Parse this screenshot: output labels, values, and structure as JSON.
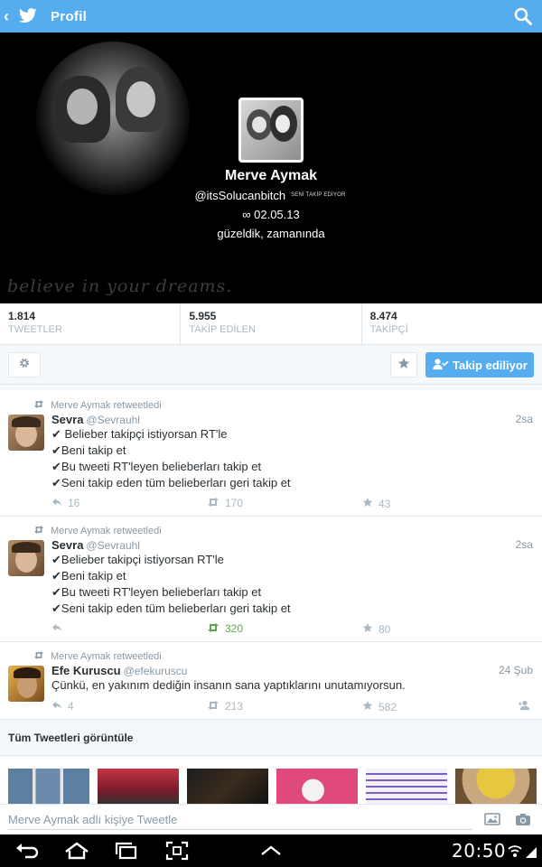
{
  "actionbar": {
    "back_icon": "back-chevron-icon",
    "logo_icon": "twitter-bird-icon",
    "title": "Profil",
    "search_icon": "search-icon"
  },
  "profile": {
    "name": "Merve Aymak",
    "handle": "@itsSolucanbitch",
    "follows_you": "SENİ TAKİP EDİYOR",
    "bio_line1": "∞ 02.05.13",
    "bio_line2": "güzeldik, zamanında",
    "header_watermark": "believe in your dreams."
  },
  "stats": [
    {
      "value": "1.814",
      "label": "TWEETLER"
    },
    {
      "value": "5.955",
      "label": "TAKİP EDİLEN"
    },
    {
      "value": "8.474",
      "label": "TAKİPÇİ"
    }
  ],
  "buttons": {
    "following": "Takip ediliyor"
  },
  "tweets": [
    {
      "retweeted_by": "Merve Aymak retweetledi",
      "name": "Sevra",
      "handle": "@Sevrauhl",
      "time": "2sa",
      "lines": [
        "✔ Belieber takipçi istiyorsan RT'le",
        "✔Beni takip et",
        "✔Bu tweeti RT'leyen belieberları takip et",
        "✔Seni takip eden tüm belieberları geri takip et"
      ],
      "reply_count": "16",
      "retweet_count": "170",
      "favorite_count": "43"
    },
    {
      "retweeted_by": "Merve Aymak retweetledi",
      "name": "Sevra",
      "handle": "@Sevrauhl",
      "time": "2sa",
      "lines": [
        "✔Belieber takipçi istiyorsan RT'le",
        "✔Beni takip et",
        "✔Bu tweeti RT'leyen belieberları takip et",
        "✔Seni takip eden tüm belieberları geri takip et"
      ],
      "reply_count": "",
      "retweet_count": "320",
      "favorite_count": "80"
    },
    {
      "retweeted_by": "Merve Aymak retweetledi",
      "name": "Efe Kuruscu",
      "handle": "@efekuruscu",
      "time": "24 Şub",
      "lines": [
        "Çünkü, en yakınım dediğin insanın sana yaptıklarını unutamıyorsun."
      ],
      "reply_count": "4",
      "retweet_count": "213",
      "favorite_count": "582"
    }
  ],
  "view_all": "Tüm Tweetleri görüntüle",
  "media_thumbnails_visible": 6,
  "compose": {
    "placeholder": "Merve Aymak adlı kişiye Tweetle"
  },
  "system": {
    "clock": "20:50"
  },
  "colors": {
    "twitter_blue": "#55acee",
    "retweet_green": "#5ea94d",
    "muted": "#8899a6",
    "header_bg": "#000000"
  }
}
